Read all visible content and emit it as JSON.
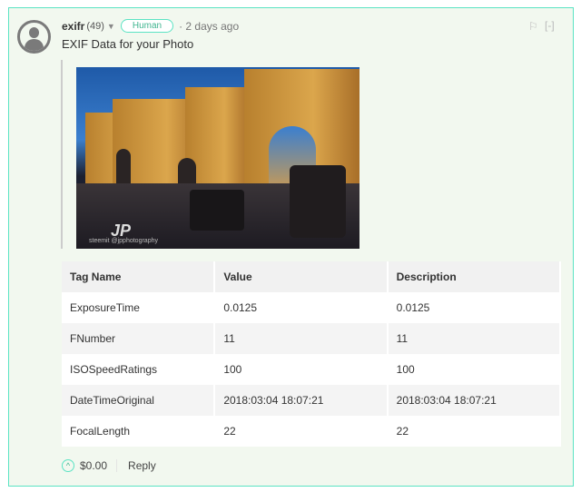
{
  "comment": {
    "author": "exifr",
    "reputation": "(49)",
    "badge": "Human",
    "time": "· 2 days ago",
    "title": "EXIF Data for your Photo",
    "flag_icon": "⚐",
    "collapse_label": "[-]"
  },
  "image": {
    "watermark_logo": "JP",
    "watermark_text": "steemit @jpphotography"
  },
  "table": {
    "headers": [
      "Tag Name",
      "Value",
      "Description"
    ],
    "rows": [
      [
        "ExposureTime",
        "0.0125",
        "0.0125"
      ],
      [
        "FNumber",
        "11",
        "11"
      ],
      [
        "ISOSpeedRatings",
        "100",
        "100"
      ],
      [
        "DateTimeOriginal",
        "2018:03:04 18:07:21",
        "2018:03:04 18:07:21"
      ],
      [
        "FocalLength",
        "22",
        "22"
      ]
    ]
  },
  "footer": {
    "payout": "$0.00",
    "reply": "Reply"
  }
}
